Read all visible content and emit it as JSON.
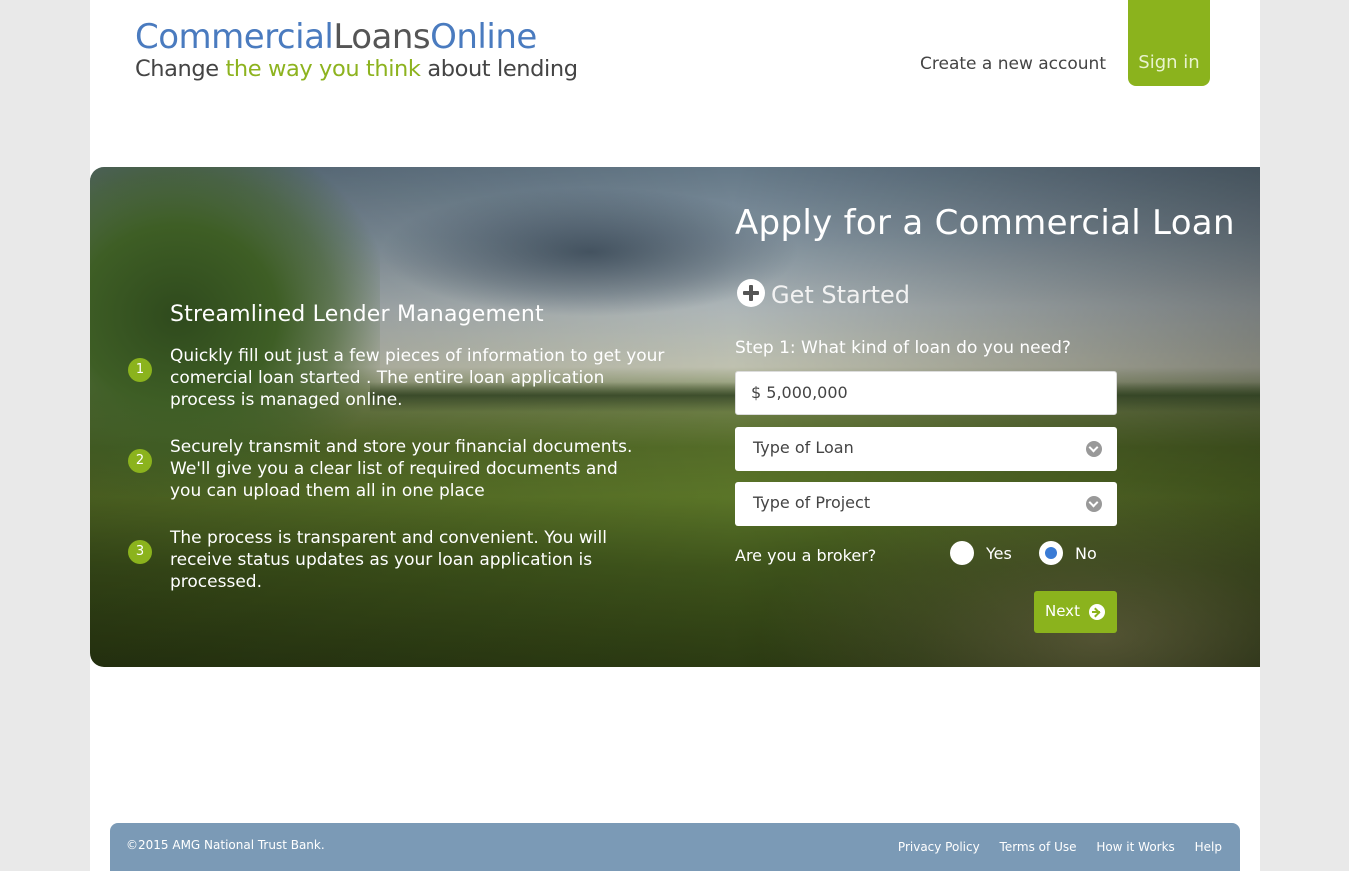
{
  "header": {
    "logo": {
      "part1": "Commercial",
      "part2": "Loans",
      "part3": "Online",
      "tagline_a": "Change ",
      "tagline_b": "the way you think",
      "tagline_c": " about lending"
    },
    "create_account": "Create a new account",
    "sign_in": "Sign in"
  },
  "features": {
    "title": "Streamlined Lender Management",
    "items": [
      {
        "number": "1",
        "text": "Quickly fill out just a few pieces of information to get your comercial loan started . The entire loan application process is managed online."
      },
      {
        "number": "2",
        "text": "Securely transmit and store your financial documents. We'll give you a clear list of required documents and you can upload them all in one place"
      },
      {
        "number": "3",
        "text": "The process is transparent and convenient. You will receive status updates as your loan application is processed."
      }
    ]
  },
  "form": {
    "title": "Apply for a Commercial Loan",
    "get_started": "Get Started",
    "step_label": "Step 1: What kind of loan do you need?",
    "amount_value": "$ 5,000,000",
    "loan_type": "Type of Loan",
    "project_type": "Type of Project",
    "broker_question": "Are you a broker?",
    "yes_label": "Yes",
    "no_label": "No",
    "broker_selected": "No",
    "next_label": "Next"
  },
  "footer": {
    "copyright": "©2015 AMG National Trust Bank.",
    "links": [
      "Privacy Policy",
      "Terms of Use",
      "How it Works",
      "Help"
    ]
  },
  "colors": {
    "brand_blue": "#4a7bbf",
    "brand_green": "#8bb31d",
    "footer_bg": "#7b9ab6",
    "radio_selected": "#3a7bd5"
  }
}
